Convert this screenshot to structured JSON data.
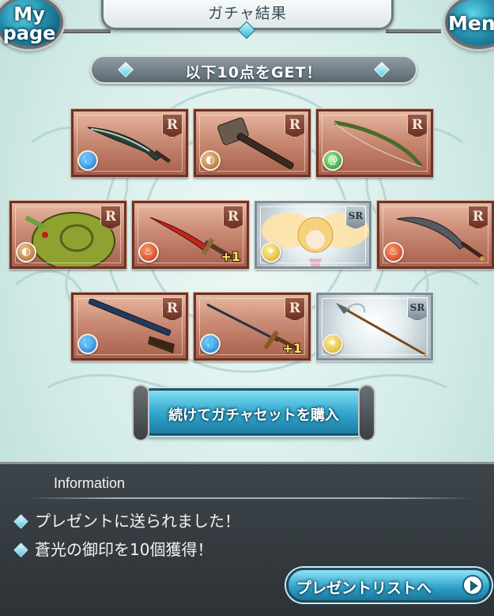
{
  "header": {
    "mypage_label_line1": "My",
    "mypage_label_line2": "page",
    "menu_label": "Menu",
    "title": "ガチャ結果"
  },
  "banner": {
    "text": "以下10点をGET！"
  },
  "items": [
    {
      "rarity": "R",
      "element": "water",
      "element_icon": "water-drop-icon",
      "weapon": "dagger",
      "bonus": ""
    },
    {
      "rarity": "R",
      "element": "earth",
      "element_icon": "earth-icon",
      "weapon": "hammer",
      "bonus": ""
    },
    {
      "rarity": "R",
      "element": "wind",
      "element_icon": "wind-swirl-icon",
      "weapon": "bow",
      "bonus": ""
    },
    {
      "rarity": "R",
      "element": "earth",
      "element_icon": "earth-icon",
      "weapon": "summon-beast",
      "bonus": ""
    },
    {
      "rarity": "R",
      "element": "fire",
      "element_icon": "fire-icon",
      "weapon": "red-dagger",
      "bonus": "+1"
    },
    {
      "rarity": "SR",
      "element": "light",
      "element_icon": "light-star-icon",
      "weapon": "summon-angel",
      "bonus": ""
    },
    {
      "rarity": "R",
      "element": "fire",
      "element_icon": "fire-icon",
      "weapon": "scimitar",
      "bonus": ""
    },
    {
      "rarity": "R",
      "element": "water",
      "element_icon": "water-drop-icon",
      "weapon": "gun",
      "bonus": ""
    },
    {
      "rarity": "R",
      "element": "water",
      "element_icon": "water-drop-icon",
      "weapon": "rapier",
      "bonus": "+1"
    },
    {
      "rarity": "SR",
      "element": "light",
      "element_icon": "light-star-icon",
      "weapon": "spear",
      "bonus": ""
    }
  ],
  "buttons": {
    "continue_label": "続けてガチャセットを購入",
    "present_list_label": "プレゼントリストへ"
  },
  "info": {
    "title": "Information",
    "lines": [
      "プレゼントに送られました！",
      "蒼光の御印を10個獲得！"
    ]
  },
  "colors": {
    "accent": "#35a9cf",
    "r_card": "#c98a74",
    "sr_card": "#e3ecef",
    "panel": "#3e454a"
  }
}
